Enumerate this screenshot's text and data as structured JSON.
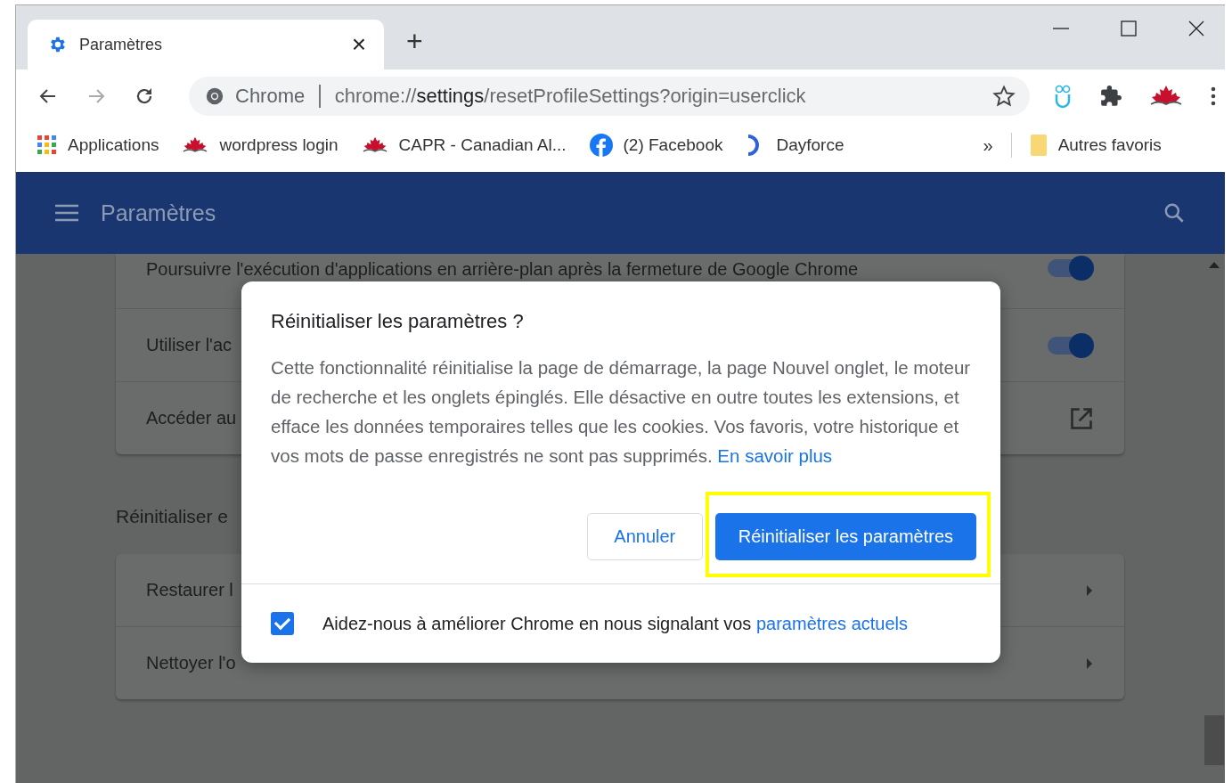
{
  "browser": {
    "tab": {
      "title": "Paramètres",
      "close": "×",
      "selected": true
    },
    "new_tab": "+",
    "address": {
      "site": "Chrome",
      "url_parts": [
        "chrome://",
        "settings",
        "/resetProfileSettings?origin=userclick"
      ]
    },
    "bookmarks": [
      {
        "kind": "apps",
        "label": "Applications"
      },
      {
        "kind": "maple",
        "label": "wordpress login"
      },
      {
        "kind": "maple",
        "label": "CAPR - Canadian Al..."
      },
      {
        "kind": "facebook",
        "label": "(2) Facebook"
      },
      {
        "kind": "dayforce",
        "label": "Dayforce"
      }
    ],
    "overflow": "»",
    "other_bookmarks": "Autres favoris"
  },
  "header": {
    "title": "Paramètres"
  },
  "sections": [
    {
      "rows": [
        {
          "kind": "toggle",
          "label": "Poursuivre l'exécution d'applications en arrière-plan après la fermeture de Google Chrome",
          "on": true
        },
        {
          "kind": "toggle",
          "label": "Utiliser l'ac",
          "on": true
        },
        {
          "kind": "external",
          "label": "Accéder au"
        }
      ]
    },
    {
      "heading": "Réinitialiser e",
      "rows": [
        {
          "kind": "arrow",
          "label": "Restaurer l"
        },
        {
          "kind": "arrow",
          "label": "Nettoyer l'o"
        }
      ]
    }
  ],
  "dialog": {
    "title": "Réinitialiser les paramètres ?",
    "body": "Cette fonctionnalité réinitialise la page de démarrage, la page Nouvel onglet, le moteur de recherche et les onglets épinglés. Elle désactive en outre toutes les extensions, et efface les données temporaires telles que les cookies. Vos favoris, votre historique et vos mots de passe enregistrés ne sont pas supprimés.",
    "link": "En savoir plus",
    "cancel": "Annuler",
    "confirm": "Réinitialiser les paramètres",
    "confirm_highlighted": true,
    "report": {
      "checked": true,
      "text": "Aidez-nous à améliorer Chrome en nous signalant vos",
      "link": "paramètres actuels"
    }
  }
}
